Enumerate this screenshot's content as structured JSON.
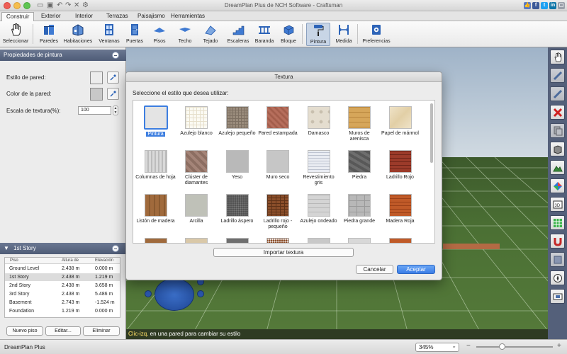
{
  "window": {
    "title": "DreamPlan Plus de NCH Software - Craftsman"
  },
  "menu_tabs": [
    "Construir",
    "Exterior",
    "Interior",
    "Terrazas",
    "Paisajismo",
    "Herramientas"
  ],
  "toolbar": {
    "tools": [
      {
        "label": "Seleccionar",
        "icon": "hand-pointer-icon"
      },
      {
        "label": "Paredes",
        "icon": "walls-icon"
      },
      {
        "label": "Habitaciones",
        "icon": "rooms-icon"
      },
      {
        "label": "Ventanas",
        "icon": "window-icon"
      },
      {
        "label": "Puertas",
        "icon": "door-icon"
      },
      {
        "label": "Pisos",
        "icon": "floor-icon"
      },
      {
        "label": "Techo",
        "icon": "ceiling-icon"
      },
      {
        "label": "Tejado",
        "icon": "roof-icon"
      },
      {
        "label": "Escaleras",
        "icon": "stairs-icon"
      },
      {
        "label": "Baranda",
        "icon": "railing-icon"
      },
      {
        "label": "Bloque",
        "icon": "block-icon"
      },
      {
        "label": "Pintura",
        "icon": "paint-roller-icon"
      },
      {
        "label": "Medida",
        "icon": "measure-icon"
      },
      {
        "label": "Preferencias",
        "icon": "preferences-icon"
      }
    ]
  },
  "paint_panel": {
    "title": "Propiedades de pintura",
    "wall_style_label": "Estilo de pared:",
    "floor_color_label": "Color de la pared:",
    "texture_scale_label": "Escala de textura(%):",
    "texture_scale_value": "100"
  },
  "story_panel": {
    "title": "1st Story",
    "columns": [
      "Piso",
      "Altura de",
      "Elevación"
    ],
    "rows": [
      {
        "name": "Ground Level",
        "height": "2.438 m",
        "elevation": "0.000 m"
      },
      {
        "name": "1st Story",
        "height": "2.438 m",
        "elevation": "1.219 m"
      },
      {
        "name": "2nd Story",
        "height": "2.438 m",
        "elevation": "3.658 m"
      },
      {
        "name": "3rd Story",
        "height": "2.438 m",
        "elevation": "5.486 m"
      },
      {
        "name": "Basement",
        "height": "2.743 m",
        "elevation": "-1.524 m"
      },
      {
        "name": "Foundation",
        "height": "1.219 m",
        "elevation": "0.000 m"
      }
    ],
    "buttons": {
      "new": "Nuevo piso",
      "edit": "Editar...",
      "delete": "Eliminar"
    }
  },
  "hint": {
    "highlight": "Clic-izq.",
    "text": " en una pared para cambiar su estilo"
  },
  "status": {
    "app_name": "DreamPlan Plus",
    "zoom": "345%"
  },
  "texture_dialog": {
    "title": "Textura",
    "prompt": "Seleccione el estilo que desea utilizar:",
    "textures": [
      {
        "label": "Pintura",
        "selected": true
      },
      {
        "label": "Azulejo blanco"
      },
      {
        "label": "Azulejo pequeño"
      },
      {
        "label": "Pared estampada"
      },
      {
        "label": "Damasco"
      },
      {
        "label": "Muros de arenisca"
      },
      {
        "label": "Papel de mármol"
      },
      {
        "label": "Columnas de hoja"
      },
      {
        "label": "Clúster de diamantes"
      },
      {
        "label": "Yeso"
      },
      {
        "label": "Muro seco"
      },
      {
        "label": "Revestimiento gris"
      },
      {
        "label": "Piedra"
      },
      {
        "label": "Ladrillo Rojo"
      },
      {
        "label": "Listón de madera"
      },
      {
        "label": "Arcilla"
      },
      {
        "label": "Ladrillo áspero"
      },
      {
        "label": "Ladrillo rojo - pequeño"
      },
      {
        "label": "Azulejo ondeado"
      },
      {
        "label": "Piedra grande"
      },
      {
        "label": "Madera Roja"
      }
    ],
    "import_button": "Importar textura",
    "cancel_button": "Cancelar",
    "accept_button": "Aceptar"
  },
  "colors": {
    "accent": "#3b7de6",
    "panel_header": "#55617c",
    "hint_highlight": "#ffe066"
  }
}
